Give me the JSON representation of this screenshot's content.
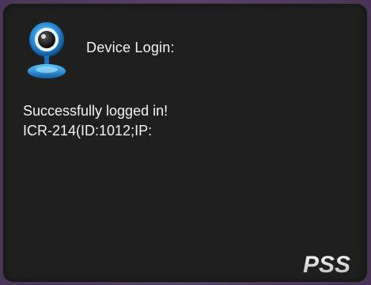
{
  "dialog": {
    "title": "Device Login:",
    "icon": "webcam-icon",
    "message_line1": "Successfully logged in!",
    "message_line2": "ICR-214(ID:1012;IP:",
    "logo_text": "PSS"
  },
  "colors": {
    "background": "#1f1f1f",
    "text": "#f2f2f2",
    "accent": "#2a8fd8"
  }
}
